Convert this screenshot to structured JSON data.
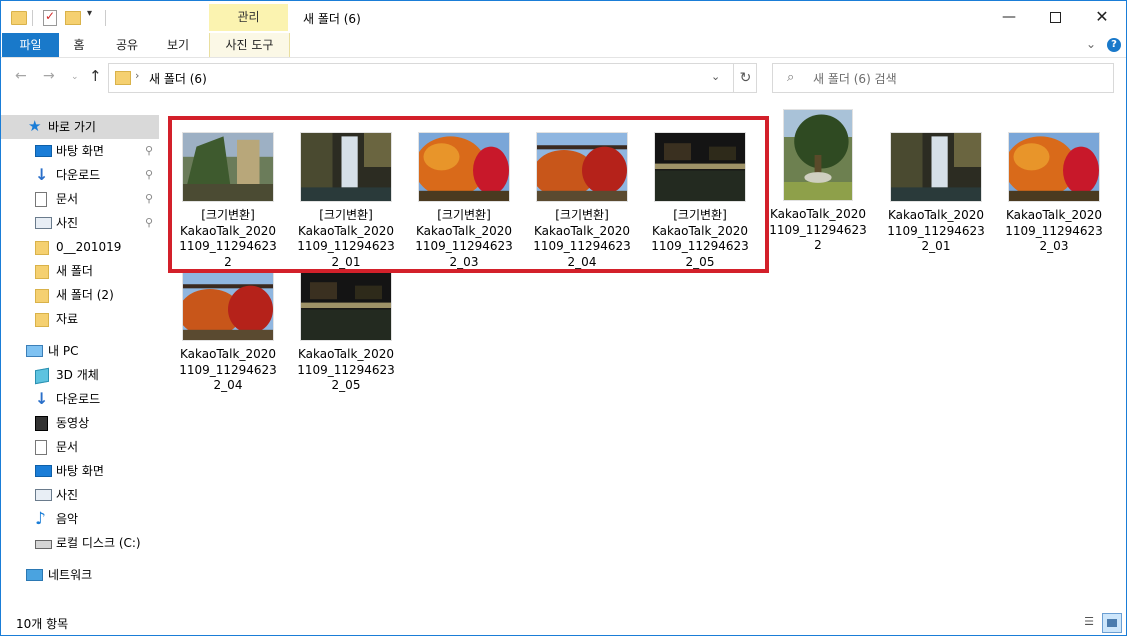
{
  "window": {
    "title": "새 폴더 (6)",
    "context_tab_group": "관리",
    "controls": {
      "minimize": "—",
      "maximize": "",
      "close": "✕"
    }
  },
  "ribbon": {
    "tabs": [
      "파일",
      "홈",
      "공유",
      "보기",
      "사진 도구"
    ],
    "help": "?",
    "collapse": "⌄"
  },
  "address": {
    "path": "새 폴더 (6)",
    "separator": "›",
    "dropdown": "⌄",
    "refresh": "↻"
  },
  "search": {
    "placeholder": "새 폴더 (6) 검색",
    "icon": "⌕"
  },
  "nav": {
    "back": "←",
    "forward": "→",
    "recent": "⌄",
    "up": "↑"
  },
  "sidebar": {
    "quick_access": {
      "label": "바로 가기",
      "icon": "star-icon"
    },
    "items": [
      {
        "label": "바탕 화면",
        "icon": "desktop-icon",
        "pinned": true
      },
      {
        "label": "다운로드",
        "icon": "download-icon",
        "pinned": true
      },
      {
        "label": "문서",
        "icon": "document-icon",
        "pinned": true
      },
      {
        "label": "사진",
        "icon": "pictures-icon",
        "pinned": true
      },
      {
        "label": "0__201019",
        "icon": "folder-icon",
        "pinned": false
      },
      {
        "label": "새 폴더",
        "icon": "folder-icon",
        "pinned": false
      },
      {
        "label": "새 폴더 (2)",
        "icon": "folder-icon",
        "pinned": false
      },
      {
        "label": "자료",
        "icon": "folder-icon",
        "pinned": false
      }
    ],
    "this_pc": {
      "label": "내 PC",
      "icon": "pc-icon"
    },
    "pc_items": [
      {
        "label": "3D 개체",
        "icon": "3d-objects-icon"
      },
      {
        "label": "다운로드",
        "icon": "download-icon"
      },
      {
        "label": "동영상",
        "icon": "video-icon"
      },
      {
        "label": "문서",
        "icon": "document-icon"
      },
      {
        "label": "바탕 화면",
        "icon": "desktop-icon"
      },
      {
        "label": "사진",
        "icon": "pictures-icon"
      },
      {
        "label": "음악",
        "icon": "music-icon"
      },
      {
        "label": "로컬 디스크 (C:)",
        "icon": "disk-icon"
      }
    ],
    "network": {
      "label": "네트워크",
      "icon": "network-icon"
    },
    "pin_glyph": "📌"
  },
  "files": [
    {
      "name": "[크기변환]KakaoTalk_20201109_112946232",
      "line1": "[크기변환]",
      "line2": "KakaoTalk_2020",
      "line3": "1109_11294623",
      "line4": "2",
      "scene": "pine",
      "selected_group": true
    },
    {
      "name": "[크기변환]KakaoTalk_20201109_112946232_01",
      "line1": "[크기변환]",
      "line2": "KakaoTalk_2020",
      "line3": "1109_11294623",
      "line4": "2_01",
      "scene": "waterfall",
      "selected_group": true
    },
    {
      "name": "[크기변환]KakaoTalk_20201109_112946232_03",
      "line1": "[크기변환]",
      "line2": "KakaoTalk_2020",
      "line3": "1109_11294623",
      "line4": "2_03",
      "scene": "maple",
      "selected_group": true
    },
    {
      "name": "[크기변환]KakaoTalk_20201109_112946232_04",
      "line1": "[크기변환]",
      "line2": "KakaoTalk_2020",
      "line3": "1109_11294623",
      "line4": "2_04",
      "scene": "bridge",
      "selected_group": true
    },
    {
      "name": "[크기변환]KakaoTalk_20201109_112946232_05",
      "line1": "[크기변환]",
      "line2": "KakaoTalk_2020",
      "line3": "1109_11294623",
      "line4": "2_05",
      "scene": "night",
      "selected_group": true
    },
    {
      "name": "KakaoTalk_20201109_112946232",
      "line1": "",
      "line2": "KakaoTalk_2020",
      "line3": "1109_11294623",
      "line4": "2",
      "scene": "pine-tall",
      "selected_group": false
    },
    {
      "name": "KakaoTalk_20201109_112946232_01",
      "line1": "",
      "line2": "KakaoTalk_2020",
      "line3": "1109_11294623",
      "line4": "2_01",
      "scene": "waterfall",
      "selected_group": false
    },
    {
      "name": "KakaoTalk_20201109_112946232_03",
      "line1": "",
      "line2": "KakaoTalk_2020",
      "line3": "1109_11294623",
      "line4": "2_03",
      "scene": "maple",
      "selected_group": false
    },
    {
      "name": "KakaoTalk_20201109_112946232_04",
      "line1": "",
      "line2": "KakaoTalk_2020",
      "line3": "1109_11294623",
      "line4": "2_04",
      "scene": "bridge",
      "selected_group": false
    },
    {
      "name": "KakaoTalk_20201109_112946232_05",
      "line1": "",
      "line2": "KakaoTalk_2020",
      "line3": "1109_11294623",
      "line4": "2_05",
      "scene": "night",
      "selected_group": false
    }
  ],
  "status": {
    "item_count": "10개 항목"
  },
  "colors": {
    "accent": "#1979ca",
    "highlight_border": "#d3202a",
    "context_tab": "#fbf3b0"
  }
}
